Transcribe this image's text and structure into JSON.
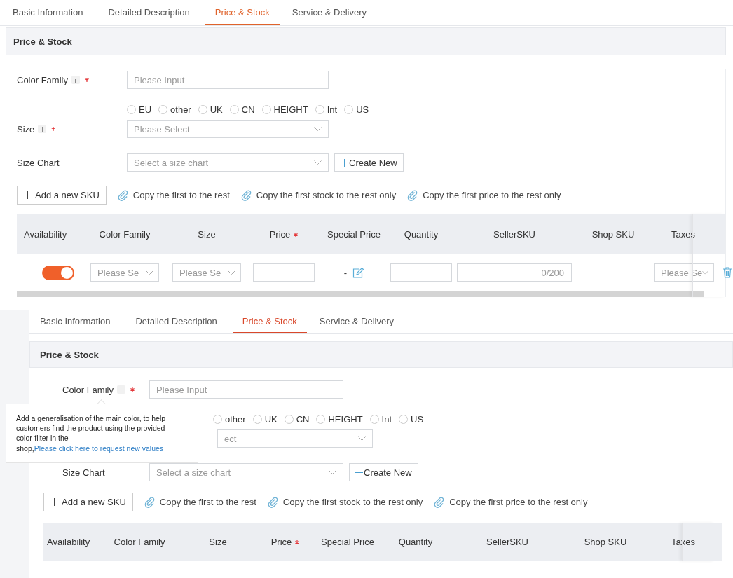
{
  "panels": [
    {
      "tabs": [
        {
          "label": "Basic Information",
          "selected": false
        },
        {
          "label": "Detailed Description",
          "selected": false
        },
        {
          "label": "Price & Stock",
          "selected": true
        },
        {
          "label": "Service & Delivery",
          "selected": false
        }
      ],
      "section_title": "Price & Stock",
      "color_family": {
        "label": "Color Family",
        "required": true,
        "placeholder": "Please Input"
      },
      "size": {
        "label": "Size",
        "required": true,
        "options": [
          {
            "label": "EU",
            "selected": false
          },
          {
            "label": "other",
            "selected": false
          },
          {
            "label": "UK",
            "selected": false
          },
          {
            "label": "CN",
            "selected": false
          },
          {
            "label": "HEIGHT",
            "selected": false
          },
          {
            "label": "Int",
            "selected": false
          },
          {
            "label": "US",
            "selected": false
          }
        ],
        "placeholder": "Please Select"
      },
      "size_chart": {
        "label": "Size Chart",
        "placeholder": "Select a size chart",
        "create_button": "Create New"
      },
      "add_sku_button": "Add a new SKU",
      "copy_actions": [
        "Copy the first to the rest",
        "Copy the first stock to the rest only",
        "Copy the first price to the rest only"
      ],
      "table": {
        "columns": [
          {
            "label": "Availability",
            "required": false
          },
          {
            "label": "Color Family",
            "required": false
          },
          {
            "label": "Size",
            "required": false
          },
          {
            "label": "Price",
            "required": true
          },
          {
            "label": "Special Price",
            "required": false
          },
          {
            "label": "Quantity",
            "required": false
          },
          {
            "label": "SellerSKU",
            "required": false
          },
          {
            "label": "Shop SKU",
            "required": false
          },
          {
            "label": "Taxes",
            "required": false
          }
        ],
        "rows": [
          {
            "available": true,
            "color_family_placeholder": "Please Se",
            "size_placeholder": "Please Se",
            "special_price": "-",
            "seller_sku_counter": "0/200",
            "taxes_placeholder": "Please Se"
          }
        ]
      }
    },
    {
      "tabs": [
        {
          "label": "Basic Information",
          "selected": false
        },
        {
          "label": "Detailed Description",
          "selected": false
        },
        {
          "label": "Price & Stock",
          "selected": true
        },
        {
          "label": "Service & Delivery",
          "selected": false
        }
      ],
      "section_title": "Price & Stock",
      "color_family": {
        "label": "Color Family",
        "required": true,
        "placeholder": "Please Input"
      },
      "tooltip": {
        "text": "Add a generalisation of the main color, to help customers find the product using the provided color-filter in the shop,",
        "link": "Please click here to request new values"
      },
      "size": {
        "options": [
          {
            "label": "other",
            "selected": false
          },
          {
            "label": "UK",
            "selected": false
          },
          {
            "label": "CN",
            "selected": false
          },
          {
            "label": "HEIGHT",
            "selected": false
          },
          {
            "label": "Int",
            "selected": false
          },
          {
            "label": "US",
            "selected": false
          }
        ],
        "placeholder": "ect"
      },
      "size_chart": {
        "label": "Size Chart",
        "placeholder": "Select a size chart",
        "create_button": "Create New"
      },
      "add_sku_button": "Add a new SKU",
      "copy_actions": [
        "Copy the first to the rest",
        "Copy the first stock to the rest only",
        "Copy the first price to the rest only"
      ],
      "table": {
        "columns": [
          {
            "label": "Availability",
            "required": false
          },
          {
            "label": "Color Family",
            "required": false
          },
          {
            "label": "Size",
            "required": false
          },
          {
            "label": "Price",
            "required": true
          },
          {
            "label": "Special Price",
            "required": false
          },
          {
            "label": "Quantity",
            "required": false
          },
          {
            "label": "SellerSKU",
            "required": false
          },
          {
            "label": "Shop SKU",
            "required": false
          },
          {
            "label": "Taxes",
            "required": false
          }
        ]
      }
    }
  ]
}
